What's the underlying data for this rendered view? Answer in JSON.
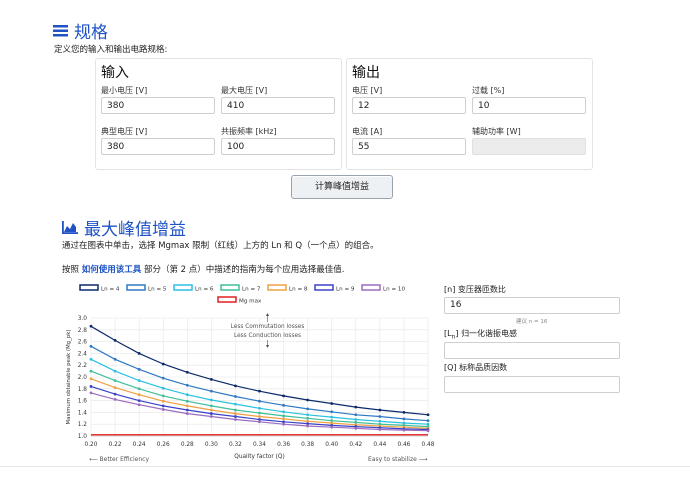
{
  "spec": {
    "title": "规格",
    "description": "定义您的输入和输出电路规格:",
    "input_panel": {
      "title": "输入",
      "fields": [
        {
          "label": "最小电压 [V]",
          "value": "380"
        },
        {
          "label": "最大电压 [V]",
          "value": "410"
        },
        {
          "label": "典型电压 [V]",
          "value": "380"
        },
        {
          "label": "共振频率 [kHz]",
          "value": "100"
        }
      ]
    },
    "output_panel": {
      "title": "输出",
      "fields": [
        {
          "label": "电压 [V]",
          "value": "12"
        },
        {
          "label": "过载 [%]",
          "value": "10"
        },
        {
          "label": "电流 [A]",
          "value": "55"
        },
        {
          "label": "辅助功率 [W]",
          "value": ""
        }
      ]
    },
    "calc_button": "计算峰值增益"
  },
  "gain": {
    "title": "最大峰值增益",
    "line1": "通过在图表中单击，选择 Mgmax 限制（红线）上方的 Ln 和 Q（一个点）的组合。",
    "line2_pre": "按照",
    "line2_link": "如何使用该工具",
    "line2_post": "部分（第 2 点）中描述的指南为每个应用选择最佳值.",
    "right": {
      "n_label": "[n] 变压器匝数比",
      "n_value": "16",
      "n_hint": "建议 n = 16",
      "ln_label": "归一化谐振电感",
      "ln_prefix": "[L",
      "ln_sub": "n",
      "ln_suffix": "]",
      "ln_value": "",
      "q_label": "[Q] 标称品质因数",
      "q_value": ""
    }
  },
  "chart_data": {
    "type": "line",
    "xlabel": "Quality factor (Q)",
    "ylabel": "Maximum obtainable peak (Mg_pk)",
    "xlim": [
      0.2,
      0.48
    ],
    "ylim": [
      1.0,
      3.0
    ],
    "x_ticks": [
      "0.20",
      "0.22",
      "0.24",
      "0.26",
      "0.28",
      "0.30",
      "0.32",
      "0.34",
      "0.36",
      "0.38",
      "0.40",
      "0.42",
      "0.44",
      "0.46",
      "0.48"
    ],
    "y_ticks": [
      "1.0",
      "1.2",
      "1.4",
      "1.6",
      "1.8",
      "2.0",
      "2.2",
      "2.4",
      "2.6",
      "2.8",
      "3.0"
    ],
    "annotation_up": "Less Commutation losses",
    "annotation_down": "Less Conduction losses",
    "foot_left": "⟵ Better Efficiency",
    "foot_right": "Easy to stabilize ⟶",
    "grid": true,
    "x": [
      0.2,
      0.22,
      0.24,
      0.26,
      0.28,
      0.3,
      0.32,
      0.34,
      0.36,
      0.38,
      0.4,
      0.42,
      0.44,
      0.46,
      0.48
    ],
    "series": [
      {
        "name": "Ln = 4",
        "color": "#0b2a6b",
        "values": [
          2.86,
          2.62,
          2.4,
          2.22,
          2.08,
          1.96,
          1.85,
          1.76,
          1.68,
          1.61,
          1.55,
          1.49,
          1.44,
          1.4,
          1.36
        ]
      },
      {
        "name": "Ln = 5",
        "color": "#2f78c4",
        "values": [
          2.52,
          2.3,
          2.13,
          1.98,
          1.86,
          1.76,
          1.67,
          1.59,
          1.52,
          1.46,
          1.41,
          1.36,
          1.33,
          1.29,
          1.26
        ]
      },
      {
        "name": "Ln = 6",
        "color": "#2bc0e0",
        "values": [
          2.3,
          2.1,
          1.94,
          1.81,
          1.7,
          1.61,
          1.54,
          1.47,
          1.41,
          1.36,
          1.32,
          1.28,
          1.25,
          1.22,
          1.2
        ]
      },
      {
        "name": "Ln = 7",
        "color": "#3fbf9a",
        "values": [
          2.1,
          1.94,
          1.8,
          1.68,
          1.59,
          1.51,
          1.44,
          1.39,
          1.34,
          1.3,
          1.26,
          1.23,
          1.2,
          1.18,
          1.16
        ]
      },
      {
        "name": "Ln = 8",
        "color": "#f0a040",
        "values": [
          1.97,
          1.82,
          1.7,
          1.59,
          1.51,
          1.44,
          1.38,
          1.33,
          1.29,
          1.25,
          1.22,
          1.19,
          1.17,
          1.15,
          1.13
        ]
      },
      {
        "name": "Ln = 9",
        "color": "#3a42c8",
        "values": [
          1.84,
          1.71,
          1.6,
          1.51,
          1.44,
          1.38,
          1.33,
          1.28,
          1.24,
          1.21,
          1.18,
          1.16,
          1.14,
          1.12,
          1.11
        ]
      },
      {
        "name": "Ln = 10",
        "color": "#9b6cc0",
        "values": [
          1.73,
          1.62,
          1.53,
          1.45,
          1.38,
          1.33,
          1.28,
          1.24,
          1.2,
          1.17,
          1.15,
          1.13,
          1.11,
          1.1,
          1.09
        ]
      },
      {
        "name": "Mg max",
        "color": "#e02020",
        "values": [
          1.02,
          1.02,
          1.02,
          1.02,
          1.02,
          1.02,
          1.02,
          1.02,
          1.02,
          1.02,
          1.02,
          1.02,
          1.02,
          1.02,
          1.02
        ]
      }
    ]
  }
}
